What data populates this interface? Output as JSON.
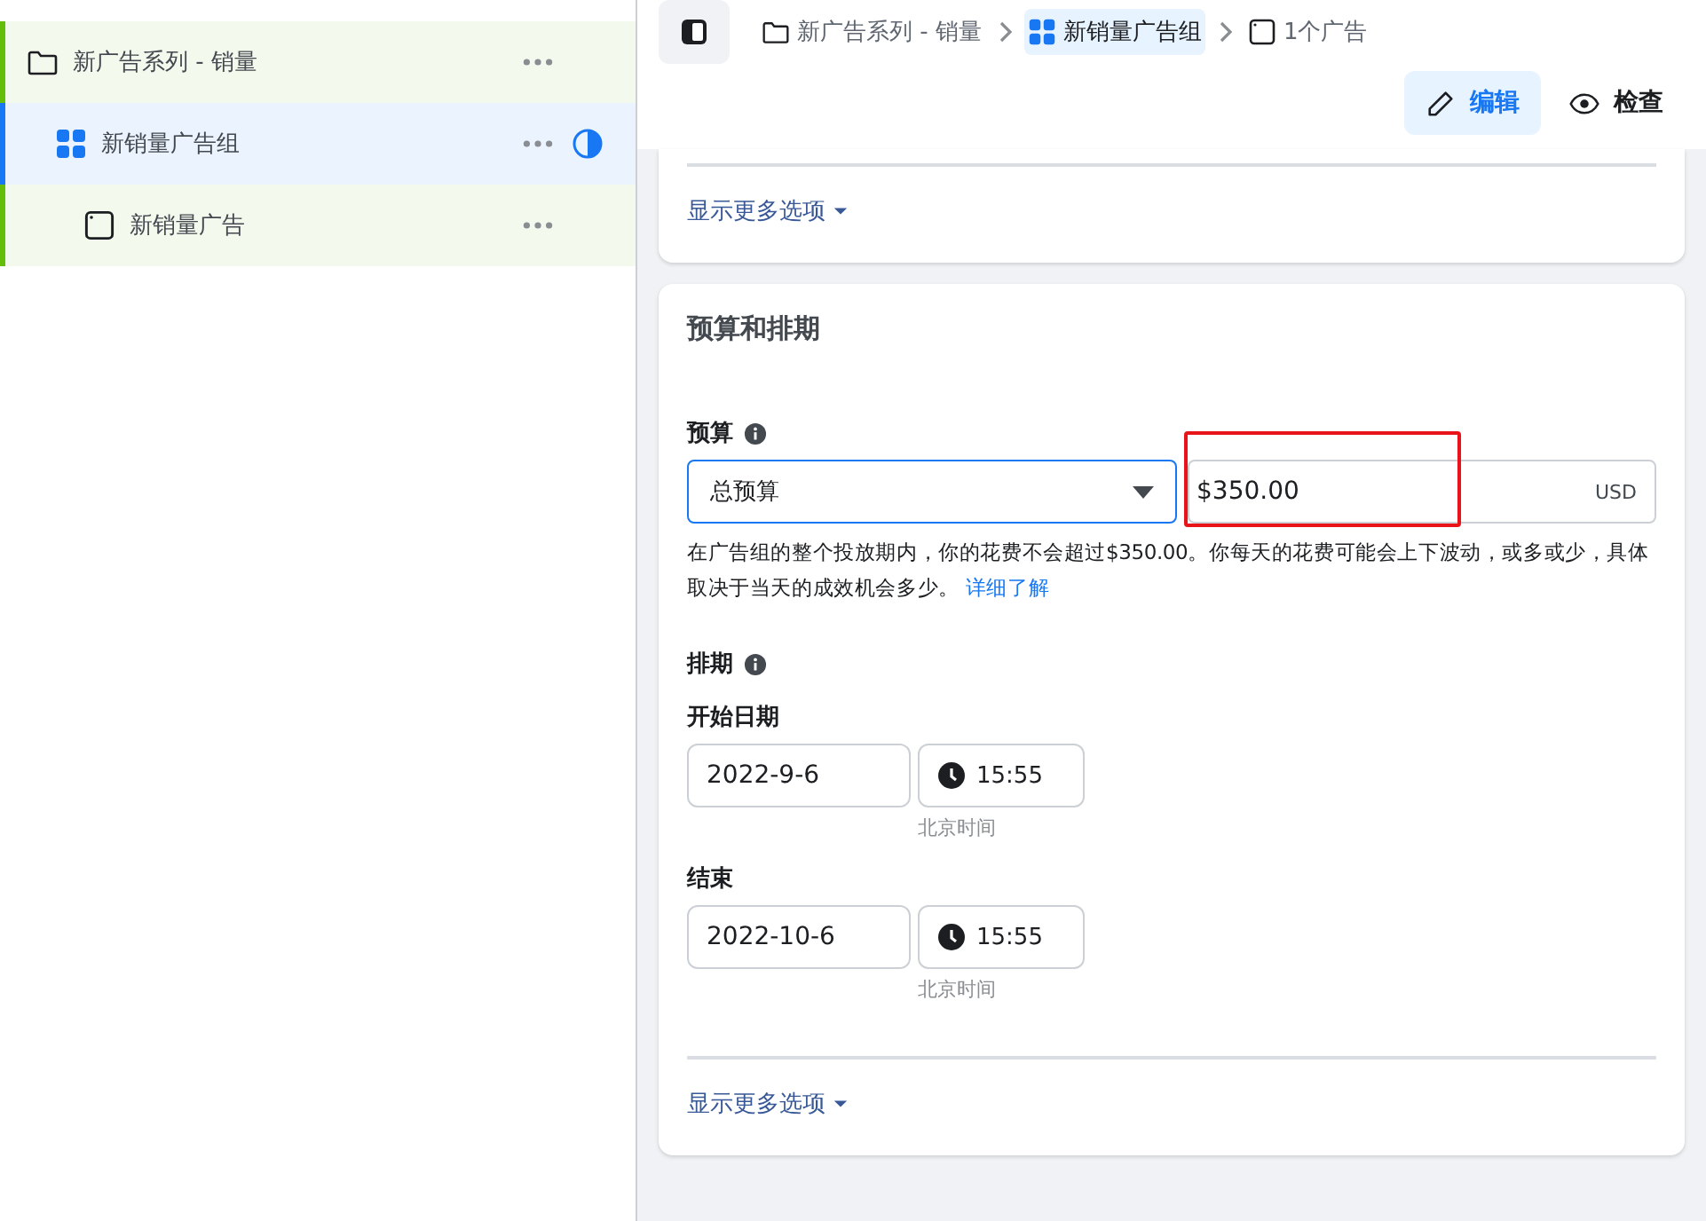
{
  "tree": [
    {
      "kind": "campaign",
      "label": "新广告系列 - 销量",
      "selected": false,
      "status": false,
      "children": [
        {
          "kind": "adset",
          "label": "新销量广告组",
          "selected": true,
          "status": true,
          "children": [
            {
              "kind": "ad",
              "label": "新销量广告",
              "selected": false,
              "status": false
            }
          ]
        }
      ]
    }
  ],
  "breadcrumb": [
    {
      "kind": "campaign",
      "label": "新广告系列 - 销量",
      "selected": false
    },
    {
      "kind": "adset",
      "label": "新销量广告组",
      "selected": true
    },
    {
      "kind": "ad",
      "label": "1个广告",
      "selected": false
    }
  ],
  "actions": [
    {
      "kind": "edit",
      "label": "编辑",
      "selected": true
    },
    {
      "kind": "view",
      "label": "检查",
      "selected": false
    }
  ],
  "top_card": {
    "more_link": "显示更多选项"
  },
  "budget_card": {
    "title": "预算和排期",
    "budget": {
      "label": "预算",
      "type_value": "总预算",
      "amount": "$350.00",
      "currency": "USD",
      "highlighted": true,
      "help": "在广告组的整个投放期内，你的花费不会超过$350.00。你每天的花费可能会上下波动，或多或少，具体取决于当天的成效机会多少。",
      "link": "详细了解"
    },
    "schedule": {
      "label": "排期",
      "dates": [
        {
          "label": "开始日期",
          "date": "2022-9-6",
          "time": "15:55",
          "timezone": "北京时间"
        },
        {
          "label": "结束",
          "date": "2022-10-6",
          "time": "15:55",
          "timezone": "北京时间"
        }
      ]
    },
    "more_link": "显示更多选项"
  }
}
